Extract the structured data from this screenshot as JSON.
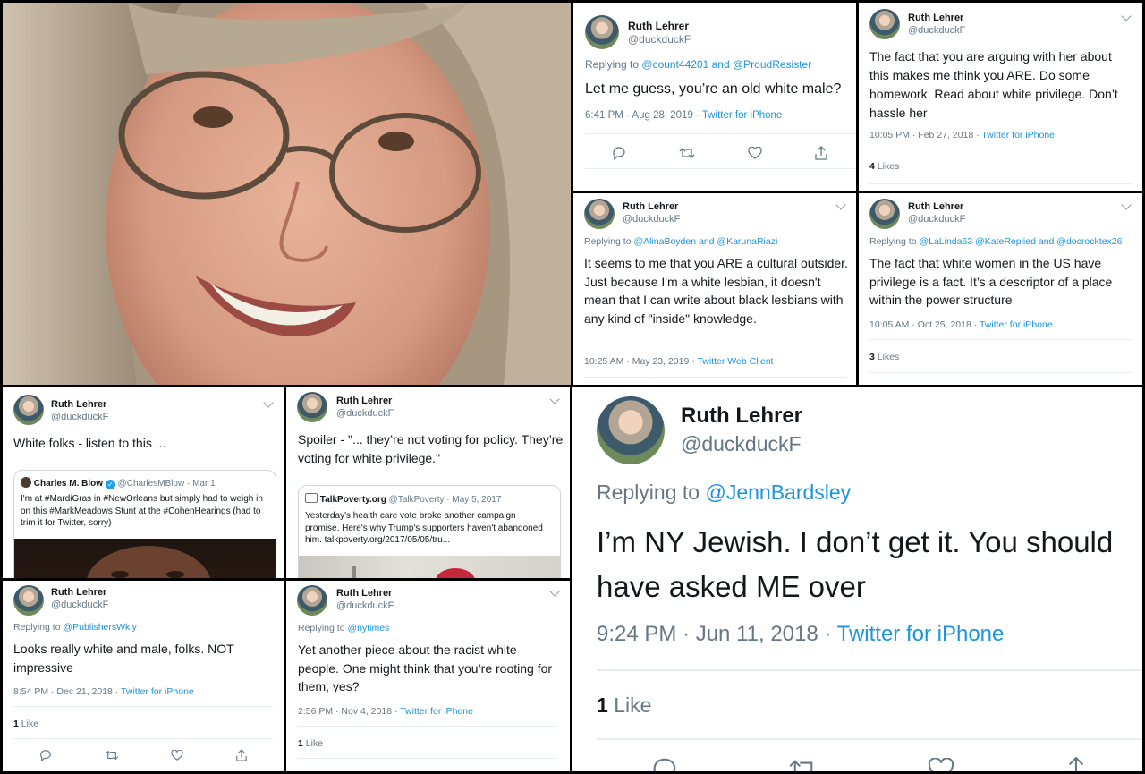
{
  "author": {
    "name": "Ruth Lehrer",
    "handle": "@duckduckF"
  },
  "t1": {
    "replying_label": "Replying to",
    "replying_to": "@count44201 and @ProudResister",
    "text": "Let me guess, you’re an old white male?",
    "time": "6:41 PM · Aug 28, 2019 ·",
    "source": "Twitter for iPhone"
  },
  "t2": {
    "text": "The fact that you are arguing with her about this makes me think you ARE. Do some homework. Read about white privilege. Don’t hassle her",
    "time": "10:05 PM · Feb 27, 2018 ·",
    "source": "Twitter for iPhone",
    "likes_count": "4",
    "likes_label": "Likes"
  },
  "t3": {
    "replying_label": "Replying to",
    "replying_to": "@AlinaBoyden and @KarunaRiazi",
    "text": "It seems to me that you ARE a cultural outsider. Just because I'm a white lesbian, it doesn't mean that I can write about black lesbians with any kind of \"inside\" knowledge.",
    "time": "10:25 AM · May 23, 2019 ·",
    "source": "Twitter Web Client"
  },
  "t4": {
    "replying_label": "Replying to",
    "replying_to": "@LaLinda63 @KateReplied and @docrocktex26",
    "text": "The fact that white women in the US have privilege is a fact. It’s a descriptor of a place within the power structure",
    "time": "10:05 AM · Oct 25, 2018 ·",
    "source": "Twitter for iPhone",
    "likes_count": "3",
    "likes_label": "Likes"
  },
  "t5": {
    "text": "White folks - listen to this ...",
    "quote": {
      "name": "Charles M. Blow",
      "handle": "@CharlesMBlow · Mar 1",
      "text": "I'm at #MardiGras in #NewOrleans but simply had to weigh in on this #MarkMeadows Stunt at the #CohenHearings (had to trim it for Twitter, sorry)"
    }
  },
  "t6": {
    "text": "Spoiler - \"... they’re not voting for policy. They’re voting for white privilege.\"",
    "quote": {
      "name": "TalkPoverty.org",
      "handle": "@TalkPoverty · May 5, 2017",
      "text": "Yesterday's health care vote broke another campaign promise. Here's why Trump's supporters haven't abandoned him. talkpoverty.org/2017/05/05/tru..."
    }
  },
  "t7": {
    "replying_label": "Replying to",
    "replying_to": "@PublishersWkly",
    "text": "Looks really white and male, folks. NOT impressive",
    "time": "8:54 PM · Dec 21, 2018 ·",
    "source": "Twitter for iPhone",
    "likes_count": "1",
    "likes_label": "Like"
  },
  "t8": {
    "replying_label": "Replying to",
    "replying_to": "@nytimes",
    "text": "Yet another piece about the racist white people. One might think that you’re rooting for them, yes?",
    "time": "2:56 PM · Nov 4, 2018 ·",
    "source": "Twitter for iPhone",
    "likes_count": "1",
    "likes_label": "Like"
  },
  "t9": {
    "replying_label": "Replying to",
    "replying_to": "@JennBardsley",
    "text": "I’m NY Jewish. I don’t get it. You should have asked ME over",
    "time": "9:24 PM · Jun 11, 2018 ·",
    "source": "Twitter for iPhone",
    "likes_count": "1",
    "likes_label": "Like"
  }
}
